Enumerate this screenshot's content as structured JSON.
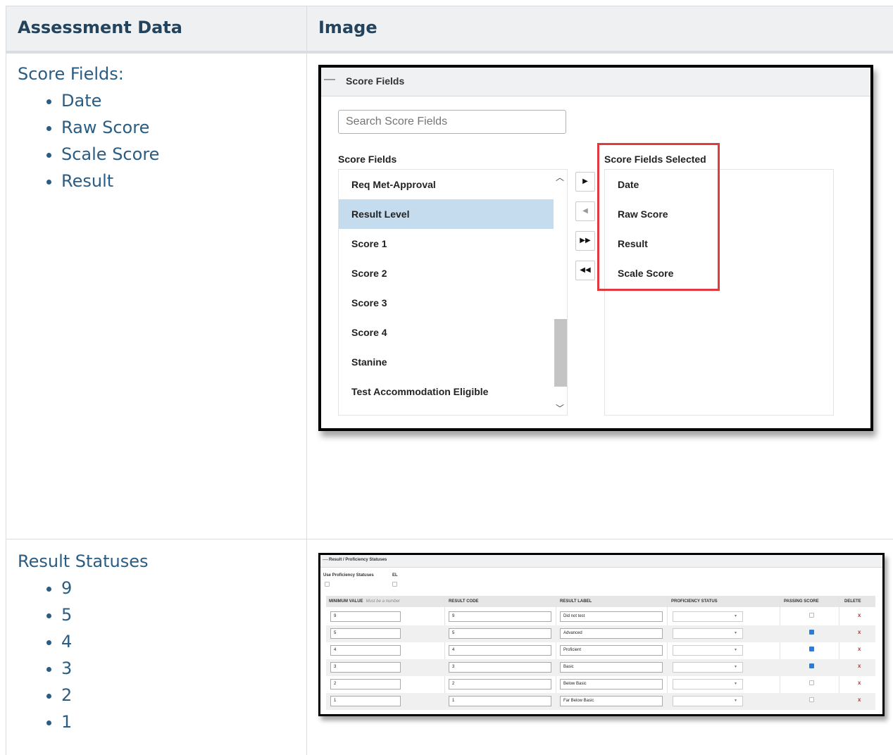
{
  "table": {
    "headers": [
      "Assessment Data",
      "Image"
    ],
    "rows": [
      {
        "label": "Score Fields:",
        "items": [
          "Date",
          "Raw Score",
          "Scale Score",
          "Result"
        ]
      },
      {
        "label": "Result Statuses",
        "items": [
          "9",
          "5",
          "4",
          "3",
          "2",
          "1"
        ]
      }
    ]
  },
  "score_fields_panel": {
    "title": "Score Fields",
    "collapse_icon": "minus-icon",
    "search_placeholder": "Search Score Fields",
    "available_label": "Score Fields",
    "selected_label": "Score Fields Selected",
    "available": [
      "Req Met-Approval",
      "Result Level",
      "Score 1",
      "Score 2",
      "Score 3",
      "Score 4",
      "Stanine",
      "Test Accommodation Eligible"
    ],
    "highlighted_item": "Result Level",
    "selected": [
      "Date",
      "Raw Score",
      "Result",
      "Scale Score"
    ],
    "buttons": [
      {
        "name": "move-right-button",
        "glyph": "▶",
        "enabled": true
      },
      {
        "name": "move-left-button",
        "glyph": "◀",
        "enabled": false
      },
      {
        "name": "move-all-right-button",
        "glyph": "▶▶",
        "enabled": true
      },
      {
        "name": "move-all-left-button",
        "glyph": "◀◀",
        "enabled": true
      }
    ],
    "highlight_color": "#e03a3e"
  },
  "result_statuses_panel": {
    "title": "Result / Proficiency Statuses",
    "use_proficiency_label": "Use Proficiency Statuses",
    "el_label": "EL",
    "columns": {
      "min_value": "MINIMUM VALUE",
      "min_value_hint": "Must be a number",
      "result_code": "RESULT CODE",
      "result_label": "RESULT LABEL",
      "proficiency_status": "PROFICIENCY STATUS",
      "passing_score": "PASSING SCORE",
      "delete": "DELETE"
    },
    "rows": [
      {
        "min": "9",
        "code": "9",
        "label": "Did not test",
        "passing": false
      },
      {
        "min": "5",
        "code": "5",
        "label": "Advanced",
        "passing": true
      },
      {
        "min": "4",
        "code": "4",
        "label": "Proficient",
        "passing": true
      },
      {
        "min": "3",
        "code": "3",
        "label": "Basic",
        "passing": true
      },
      {
        "min": "2",
        "code": "2",
        "label": "Below Basic",
        "passing": false
      },
      {
        "min": "1",
        "code": "1",
        "label": "Far Below Basic",
        "passing": false
      }
    ],
    "delete_glyph": "x",
    "dropdown_glyph": "▾"
  }
}
